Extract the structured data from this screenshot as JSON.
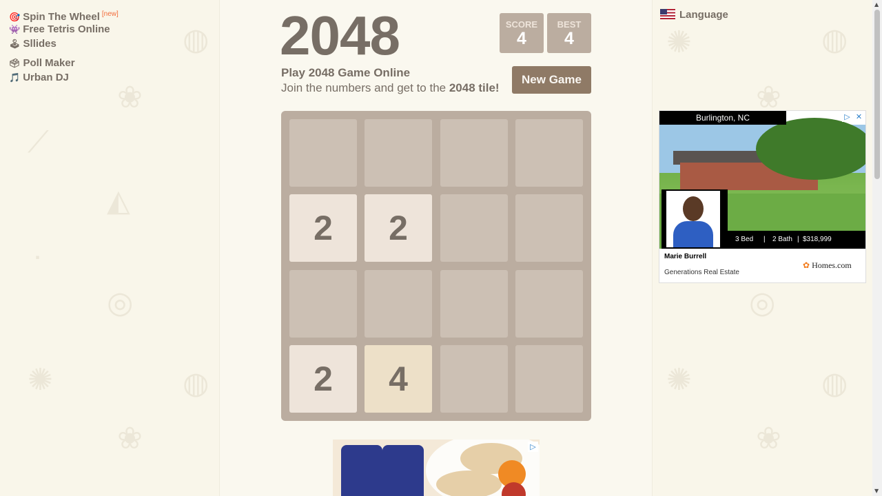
{
  "links": [
    {
      "icon": "🎯",
      "label": "Spin The Wheel",
      "badge": "[new]"
    },
    {
      "icon": "👾",
      "label": "Free Tetris Online"
    },
    {
      "icon": "🕹",
      "label": "Sllides"
    },
    {
      "icon": "🗳",
      "label": "Poll Maker"
    },
    {
      "icon": "🎵",
      "label": "Urban DJ"
    }
  ],
  "language": {
    "label": "Language",
    "flag": "us-flag-icon"
  },
  "game": {
    "title": "2048",
    "score_label": "SCORE",
    "score": "4",
    "best_label": "BEST",
    "best": "4",
    "heading": "Play 2048 Game Online",
    "subtitle_prefix": "Join the numbers and get to the ",
    "subtitle_bold": "2048 tile!",
    "new_game": "New Game",
    "grid": [
      [
        null,
        null,
        null,
        null
      ],
      [
        2,
        2,
        null,
        null
      ],
      [
        null,
        null,
        null,
        null
      ],
      [
        2,
        4,
        null,
        null
      ]
    ]
  },
  "ad": {
    "city": "Burlington, NC",
    "beds": "3 Bed",
    "baths": "2 Bath",
    "price": "$318,999",
    "agent": "Marie Burrell",
    "agency": "Generations Real Estate",
    "brand": "Homes.com"
  },
  "colors": {
    "board": "#bbada0",
    "tile2": "#eee4da",
    "tile4": "#ede0c8",
    "button": "#8f7a66"
  }
}
